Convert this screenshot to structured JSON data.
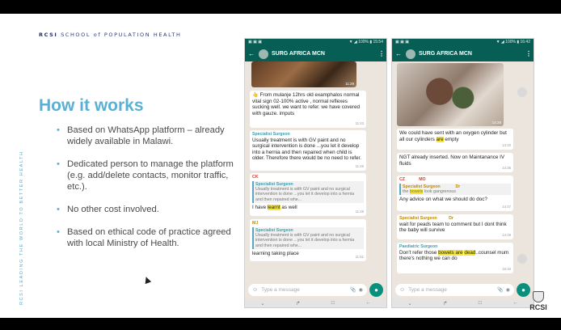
{
  "slide": {
    "org_prefix": "RCSI",
    "org_name": "SCHOOL of POPULATION HEALTH",
    "side_text": "RCSI LEADING THE WORLD TO BETTER HEALTH",
    "title": "How it works",
    "bullets": [
      "Based on WhatsApp platform – already widely available in Malawi.",
      "Dedicated person to manage the platform (e.g. add/delete contacts, monitor traffic, etc.).",
      "No other cost involved.",
      "Based on ethical code of practice agreed with local Ministry of Health."
    ],
    "logo_text": "RCSI"
  },
  "colors": {
    "accent": "#5ab0d2",
    "whatsapp_bar": "#075e54",
    "chat_bg": "#ece5dd",
    "highlight": "#f4e53a"
  },
  "phone1": {
    "status_right": "▼ ◢ 100% ▮ 15:54",
    "status_left": "▣ ▣ ▣",
    "group_name": "SURG AFRICA MCN",
    "image_time": "11:29",
    "messages": {
      "m1_text": "👆 From mulanje 12hrs  old examphalos normal vital sign 02-100% active , normal reflexes sucking well. we want to refer. we have covered with gauze. imputs",
      "m1_time": "11:43",
      "m2_sender": "Specialist Surgeon",
      "m2_text": "Usually treatment is with GV paint and no surgical intervention is done ...you let it develop into a hernia and then repaired when child is older. Therefore there would be no need to refer.",
      "m2_time": "11:45",
      "m3_sender": "CK",
      "m3_quote_sender": "Specialist Surgeon",
      "m3_quote": "Usually treatment is with GV paint and no surgical intervention is done ...you let it develop into a hernia and then repaired whe...",
      "m3_pre": "I have ",
      "m3_hl": "learnt",
      "m3_post": " as well",
      "m3_time": "11:48",
      "m4_sender": "MJ",
      "m4_quote_sender": "Specialist Surgeon",
      "m4_quote": "Usually treatment is with GV paint and no surgical intervention is done ...you let it develop into a hernia and then repaired whe...",
      "m4_text": "learning taking place",
      "m4_time": "11:51"
    },
    "input_placeholder": "Type a message"
  },
  "phone2": {
    "status_right": "▼ ◢ 100% ▮ 16:42",
    "status_left": "▣ ▣ ▣",
    "group_name": "SURG AFRICA MCN",
    "image_time": "14:28",
    "messages": {
      "m1_pre": "We could have sent with an oxygen cylinder but all our cylinders ",
      "m1_hl": "are",
      "m1_post": " empty",
      "m1_time": "14:32",
      "m2_text": "NGT already inserted. Now on Maintanance IV fluids",
      "m2_time": "14:36",
      "m3_sender_a": "CZ",
      "m3_sender_b": "MO",
      "m3_quote_sender": "Specialist Surgeon",
      "m3_quote_sender2": "Dr",
      "m3_quote_pre": "the ",
      "m3_quote_hl": "bowels",
      "m3_quote_post": " look gangrenous",
      "m3_text": "Any advice on what we should do doc?",
      "m3_time": "14:47",
      "m4_sender": "Specialist Surgeon",
      "m4_sender2": "Dr",
      "m4_text": "wait for peads team to comment  but I dont think the baby will survive",
      "m4_time": "14:49",
      "m5_sender": "Paediatric Surgeon",
      "m5_pre": "Don't refer those ",
      "m5_hl1": "bowels are",
      "m5_hl2": "dead",
      "m5_post": "..counsel mum there's nothing we can do",
      "m5_time": "16:40"
    },
    "input_placeholder": "Type a message"
  },
  "icons": {
    "back": "back-arrow-icon",
    "menu": "more-options-icon",
    "emoji": "emoji-icon",
    "attach": "attach-icon",
    "camera": "camera-icon",
    "mic": "mic-icon",
    "share": "share-icon"
  }
}
